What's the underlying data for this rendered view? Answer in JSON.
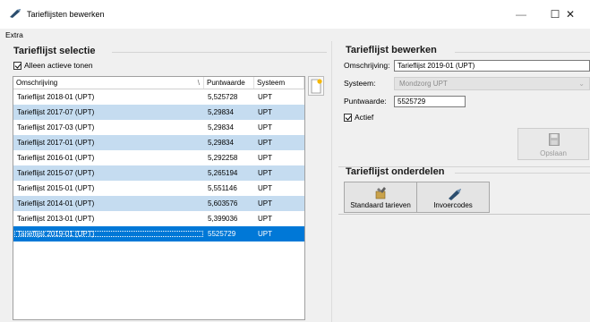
{
  "window": {
    "title": "Tarieflijsten bewerken",
    "minimize": "—",
    "maximize": "☐",
    "close": "✕"
  },
  "menu": {
    "extra": "Extra"
  },
  "selectie": {
    "title": "Tarieflijst selectie",
    "filter_label": "Alleen actieve tonen",
    "filter_checked": true,
    "columns": [
      "Omschrijving",
      "Puntwaarde",
      "Systeem"
    ],
    "rows": [
      {
        "omschrijving": "Tarieflijst 2018-01 (UPT)",
        "puntwaarde": "5,525728",
        "systeem": "UPT"
      },
      {
        "omschrijving": "Tarieflijst 2017-07 (UPT)",
        "puntwaarde": "5,29834",
        "systeem": "UPT"
      },
      {
        "omschrijving": "Tarieflijst 2017-03 (UPT)",
        "puntwaarde": "5,29834",
        "systeem": "UPT"
      },
      {
        "omschrijving": "Tarieflijst 2017-01 (UPT)",
        "puntwaarde": "5,29834",
        "systeem": "UPT"
      },
      {
        "omschrijving": "Tarieflijst 2016-01 (UPT)",
        "puntwaarde": "5,292258",
        "systeem": "UPT"
      },
      {
        "omschrijving": "Tarieflijst 2015-07 (UPT)",
        "puntwaarde": "5,265194",
        "systeem": "UPT"
      },
      {
        "omschrijving": "Tarieflijst 2015-01 (UPT)",
        "puntwaarde": "5,551146",
        "systeem": "UPT"
      },
      {
        "omschrijving": "Tarieflijst 2014-01 (UPT)",
        "puntwaarde": "5,603576",
        "systeem": "UPT"
      },
      {
        "omschrijving": "Tarieflijst 2013-01 (UPT)",
        "puntwaarde": "5,399036",
        "systeem": "UPT"
      },
      {
        "omschrijving": "Tarieflijst 2019-01 (UPT)",
        "puntwaarde": "5525729",
        "systeem": "UPT"
      }
    ],
    "selected_index": 9
  },
  "bewerken": {
    "title": "Tarieflijst bewerken",
    "omschrijving_label": "Omschrijving:",
    "omschrijving_value": "Tarieflijst 2019-01 (UPT)",
    "systeem_label": "Systeem:",
    "systeem_value": "Mondzorg UPT",
    "puntwaarde_label": "Puntwaarde:",
    "puntwaarde_value": "5525729",
    "actief_label": "Actief",
    "actief_checked": true,
    "save_label": "Opslaan"
  },
  "onderdelen": {
    "title": "Tarieflijst onderdelen",
    "standaard_label": "Standaard tarieven",
    "invoercodes_label": "Invoercodes"
  },
  "colors": {
    "row_alt": "#c5dcf0",
    "row_selected": "#0078d7"
  }
}
